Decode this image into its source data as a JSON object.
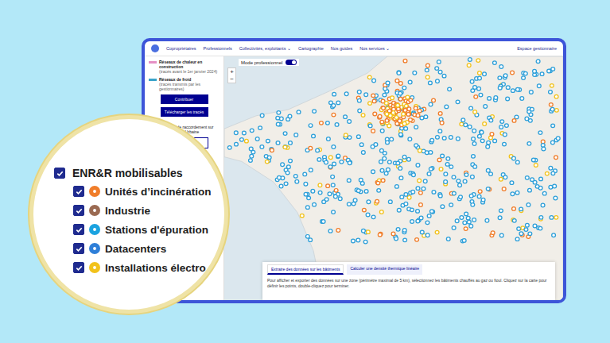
{
  "nav": {
    "items": [
      "Copropriétaires",
      "Professionnels",
      "Collectivités, exploitants ⌄",
      "Cartographie",
      "Nos guides",
      "Nos services ⌄",
      "Espace gestionnaire"
    ]
  },
  "mode": {
    "label": "Mode professionnel",
    "on": true
  },
  "sidebar": {
    "legend": [
      {
        "label": "Réseaux de chaleur en construction",
        "note": "(tracés avant le 1er janvier 2024)",
        "color": "#e58fc4"
      },
      {
        "label": "Réseaux de froid",
        "note": "(tracés transmis par les gestionnaires)",
        "color": "#3aa3c9"
      }
    ],
    "buttons": [
      "Contribuer",
      "Télécharger les tracés"
    ],
    "request": {
      "label": "Demandes de raccordement sur France Chaleur Urbaine",
      "checked": false
    },
    "request_button": "raccordement"
  },
  "map": {
    "zoom": [
      "+",
      "−"
    ]
  },
  "panel": {
    "tabs": [
      {
        "label": "Extraire des données sur les bâtiments",
        "selected": true
      },
      {
        "label": "Calculer une densité thermique linéaire",
        "selected": false
      }
    ],
    "text": "Pour afficher et exporter des données sur une zone (périmètre maximal de 5 km), sélectionnez les bâtiments chauffés au gaz ou fioul. Cliquez sur la carte pour définir les points, double-cliquez pour terminer."
  },
  "magnifier": {
    "group": {
      "label": "ENR&R mobilisables",
      "checked": true
    },
    "items": [
      {
        "label": "Unités d’incinération",
        "checked": true,
        "color": "#f07d2a"
      },
      {
        "label": "Industrie",
        "checked": true,
        "color": "#9a6a52"
      },
      {
        "label": "Stations d'épuration",
        "checked": true,
        "color": "#1ba3e0"
      },
      {
        "label": "Datacenters",
        "checked": true,
        "color": "#2f7fd8"
      },
      {
        "label": "Installations électro",
        "checked": true,
        "color": "#f2c21b"
      }
    ]
  }
}
